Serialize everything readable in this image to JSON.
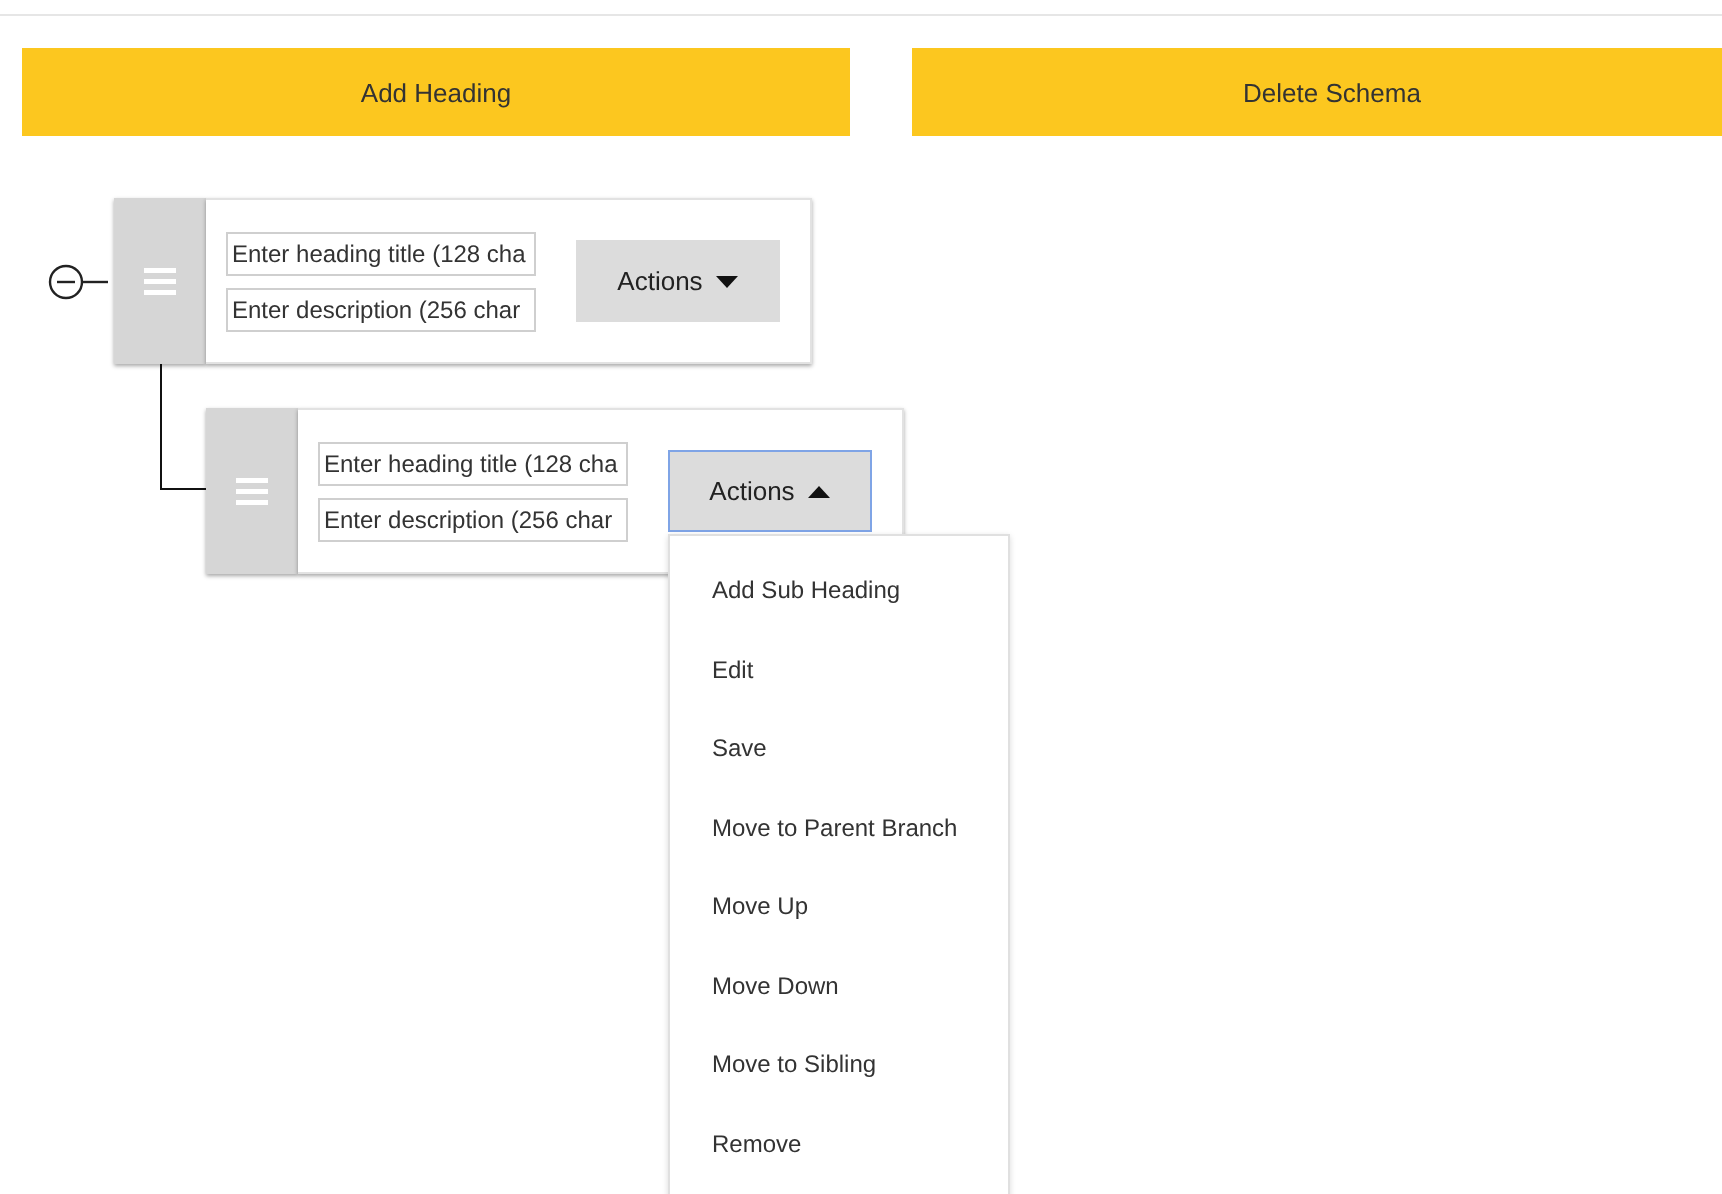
{
  "toolbar": {
    "buttons": [
      "Add Heading",
      "Delete Schema"
    ]
  },
  "headings": [
    {
      "expanded": true,
      "title_placeholder": "Enter heading title (128 cha",
      "description_placeholder": "Enter description (256 char",
      "actions": {
        "label": "Actions",
        "menu_open": false
      },
      "children": [
        {
          "title_placeholder": "Enter heading title (128 cha",
          "description_placeholder": "Enter description (256 char",
          "actions": {
            "label": "Actions",
            "menu_open": true,
            "menu_items": [
              "Add Sub Heading",
              "Edit",
              "Save",
              "Move to Parent Branch",
              "Move Up",
              "Move Down",
              "Move to Sibling",
              "Remove"
            ]
          }
        }
      ]
    }
  ]
}
